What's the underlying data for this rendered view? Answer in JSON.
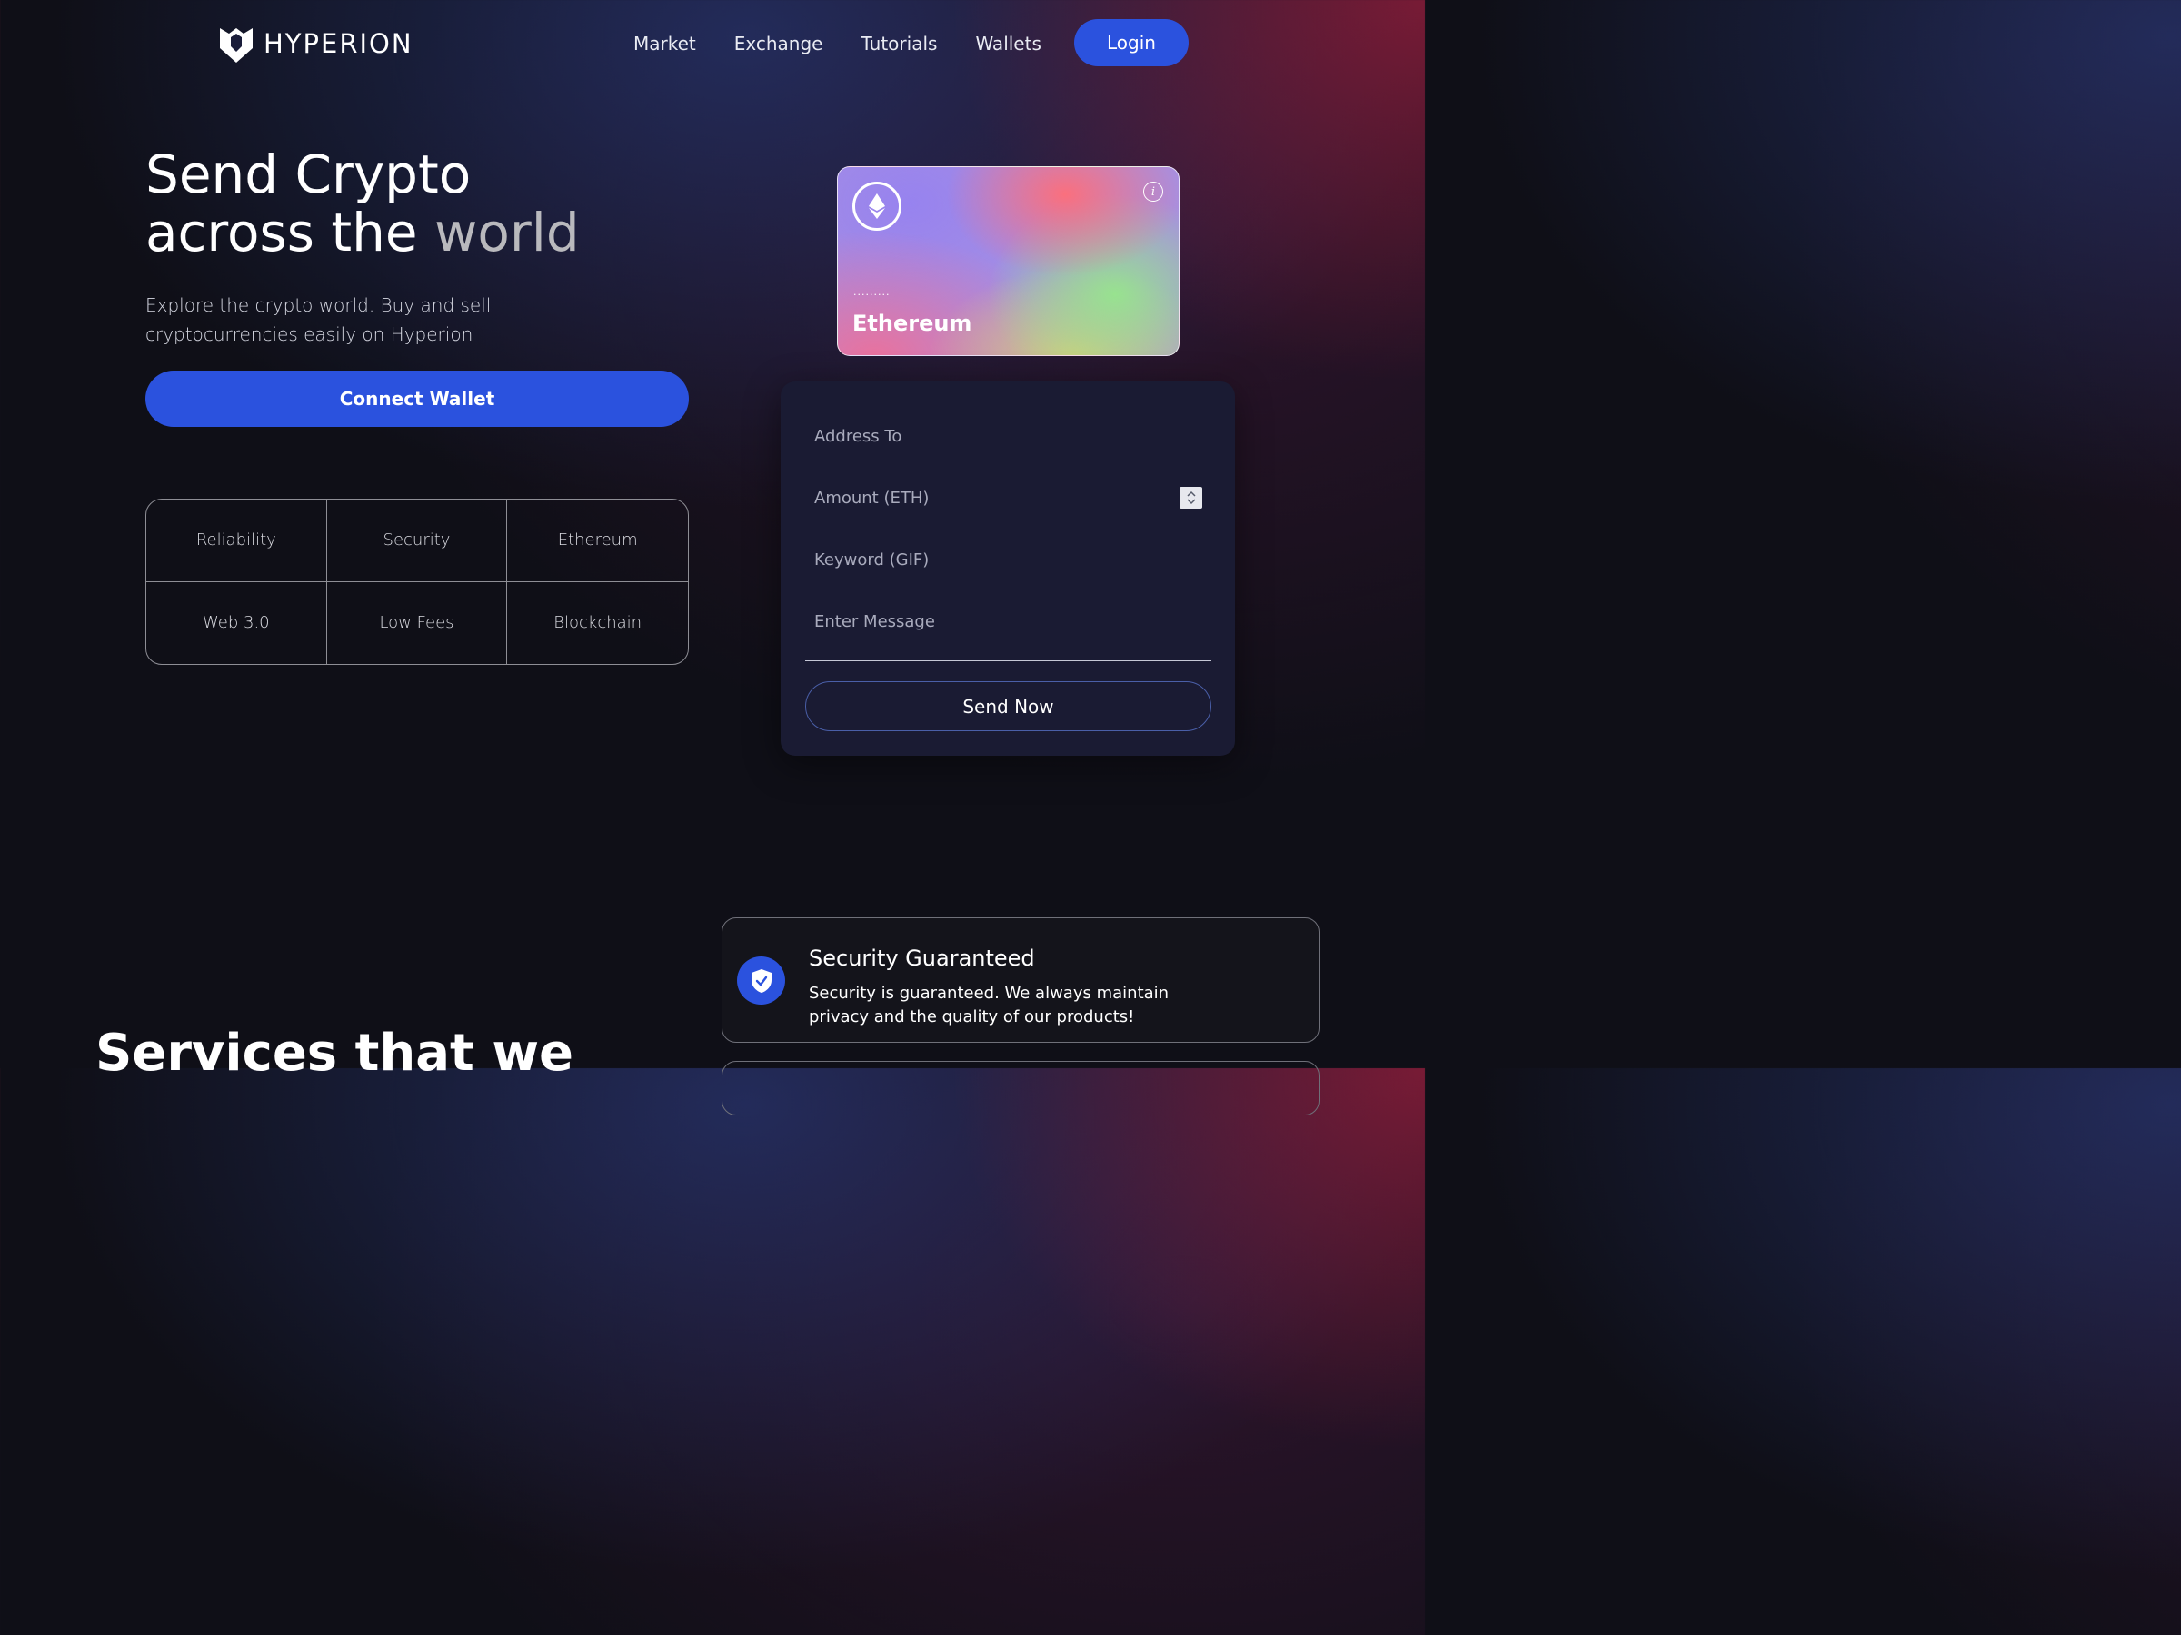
{
  "header": {
    "brand": "HYPERION",
    "nav": [
      "Market",
      "Exchange",
      "Tutorials",
      "Wallets"
    ],
    "login_label": "Login"
  },
  "hero": {
    "title_line1": "Send Crypto",
    "title_line2_a": "across the ",
    "title_line2_b": "world",
    "subtitle": "Explore the crypto world. Buy and sell cryptocurrencies easily on Hyperion",
    "connect_label": "Connect Wallet",
    "features": [
      "Reliability",
      "Security",
      "Ethereum",
      "Web 3.0",
      "Low Fees",
      "Blockchain"
    ]
  },
  "card": {
    "address_mask": "·········",
    "network": "Ethereum",
    "info_glyph": "i"
  },
  "form": {
    "address_placeholder": "Address To",
    "amount_placeholder": "Amount (ETH)",
    "keyword_placeholder": "Keyword (GIF)",
    "message_placeholder": "Enter Message",
    "send_label": "Send Now"
  },
  "services": {
    "heading": "Services that we",
    "card_title": "Security Guaranteed",
    "card_desc": "Security is guaranteed. We always maintain privacy and the quality of our products!"
  },
  "colors": {
    "accent": "#2b52de",
    "panel": "#1a1b33",
    "background": "#0f0f17"
  }
}
